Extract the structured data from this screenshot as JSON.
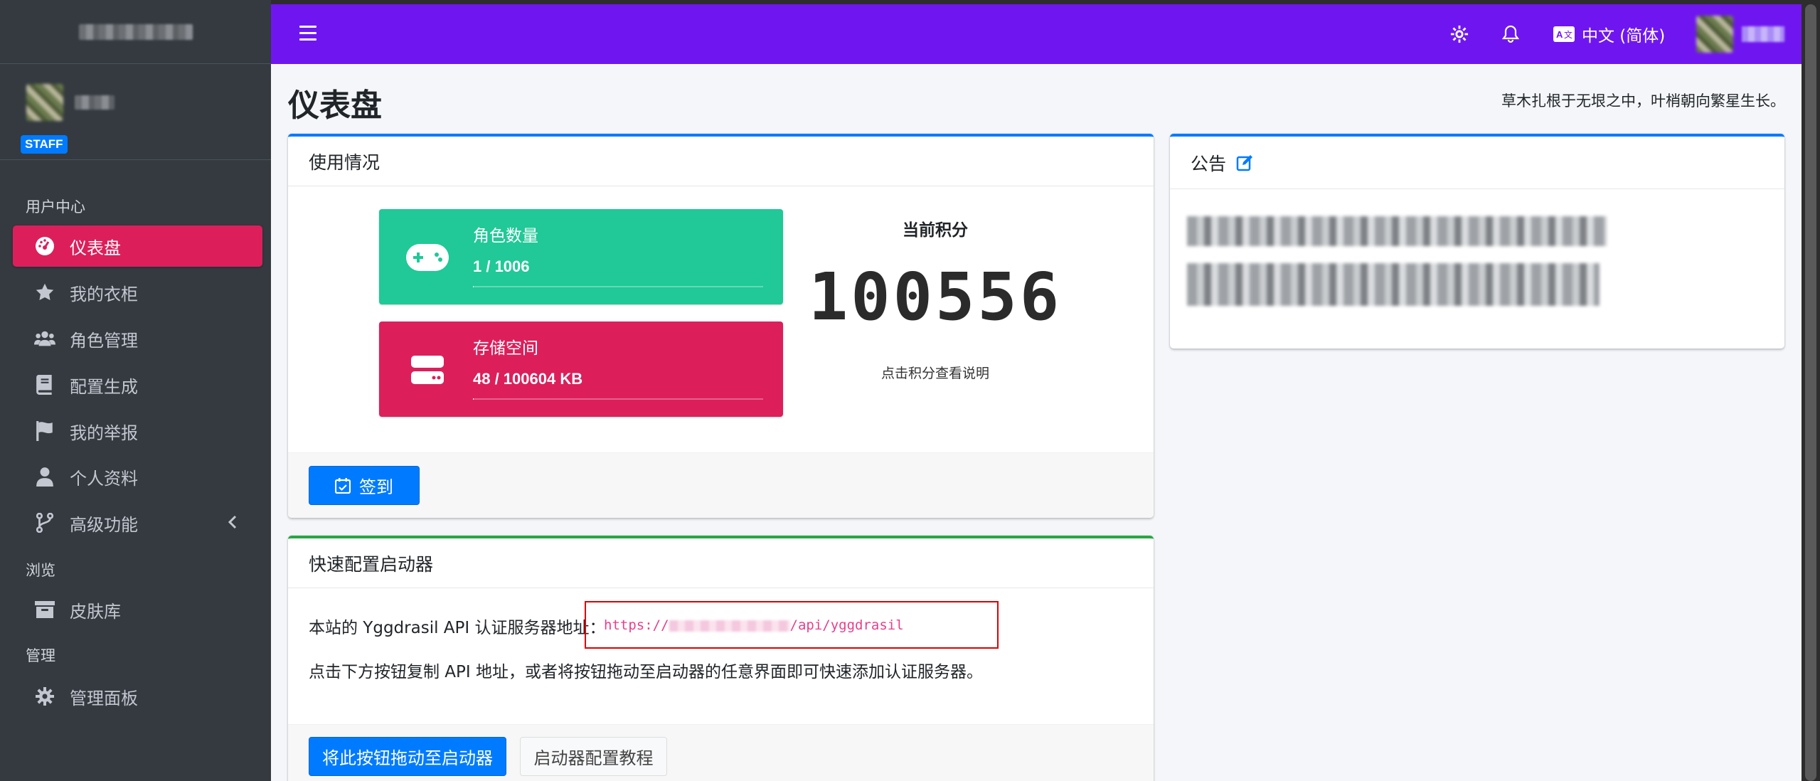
{
  "app": {
    "page_title": "仪表盘",
    "slogan": "草木扎根于无垠之中，叶梢朝向繁星生长。"
  },
  "sidebar": {
    "badge": "STAFF",
    "sections": {
      "user_center": "用户中心",
      "browse": "浏览",
      "manage": "管理"
    },
    "items": [
      {
        "label": "仪表盘",
        "icon": "tachometer-icon",
        "active": true
      },
      {
        "label": "我的衣柜",
        "icon": "star-icon"
      },
      {
        "label": "角色管理",
        "icon": "users-icon"
      },
      {
        "label": "配置生成",
        "icon": "book-icon"
      },
      {
        "label": "我的举报",
        "icon": "flag-icon"
      },
      {
        "label": "个人资料",
        "icon": "user-icon"
      },
      {
        "label": "高级功能",
        "icon": "code-branch-icon"
      },
      {
        "label": "皮肤库",
        "icon": "archive-icon"
      },
      {
        "label": "管理面板",
        "icon": "gear-icon"
      }
    ]
  },
  "navbar": {
    "language": "中文 (简体)"
  },
  "usage": {
    "title": "使用情况",
    "players": {
      "label": "角色数量",
      "value": "1 / 1006",
      "progress": 0.001
    },
    "storage": {
      "label": "存储空间",
      "value": "48 / 100604 KB",
      "progress": 0.0005
    },
    "score_label": "当前积分",
    "score_value": "100556",
    "score_hint": "点击积分查看说明",
    "sign_in": "签到"
  },
  "announcement": {
    "title": "公告"
  },
  "quick_config": {
    "title": "快速配置启动器",
    "api_prefix_text": "本站的 Yggdrasil API 认证服务器地址：",
    "api_url_start": "https://",
    "api_url_end": "/api/yggdrasil",
    "instructions": "点击下方按钮复制 API 地址，或者将按钮拖动至启动器的任意界面即可快速添加认证服务器。",
    "drag_button": "将此按钮拖动至启动器",
    "tutorial_button": "启动器配置教程"
  },
  "colors": {
    "navbar": "#6f16f0",
    "active": "#dc1f5b",
    "teal": "#20c997",
    "pink": "#dc1f5b",
    "primary": "#007bff"
  }
}
